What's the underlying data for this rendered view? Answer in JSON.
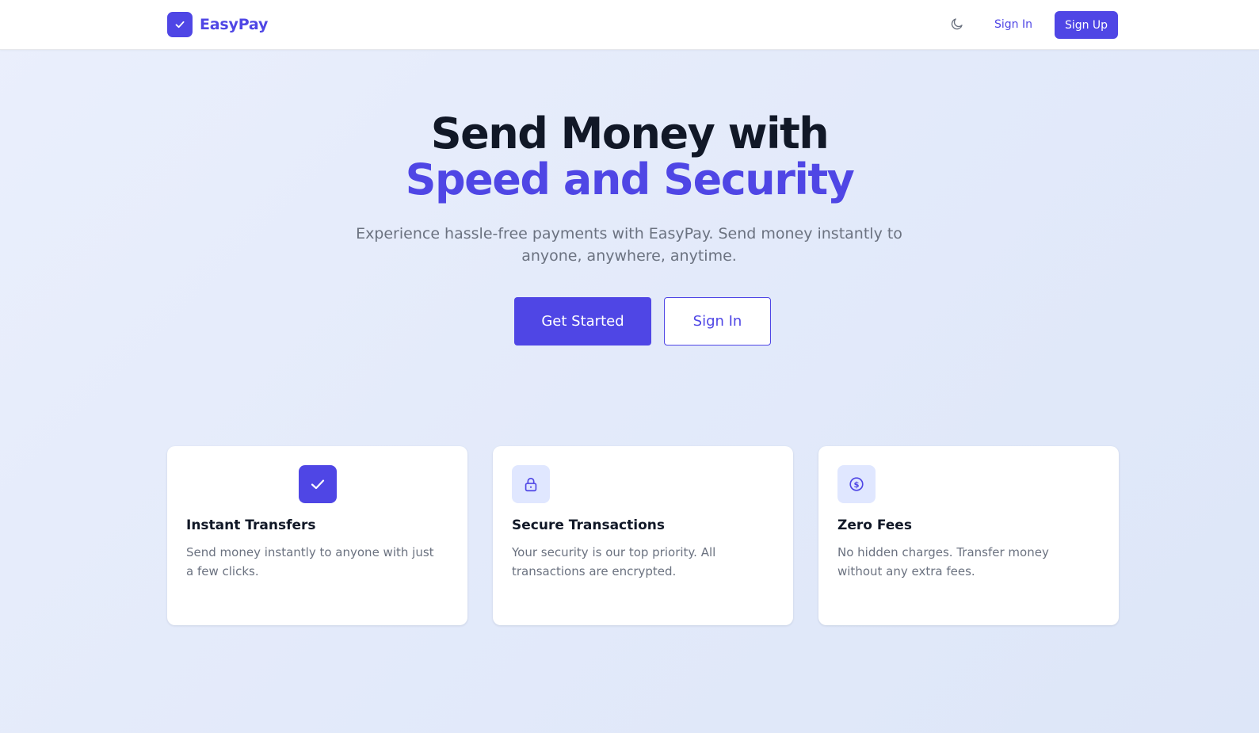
{
  "header": {
    "brand_name": "EasyPay",
    "nav_signin": "Sign In",
    "nav_signup": "Sign Up",
    "theme_icon": "moon-icon"
  },
  "hero": {
    "title_line1": "Send Money with",
    "title_line2": "Speed and Security",
    "subtitle": "Experience hassle-free payments with EasyPay. Send money instantly to anyone, anywhere, anytime.",
    "cta_primary": "Get Started",
    "cta_secondary": "Sign In"
  },
  "features": [
    {
      "icon": "check-icon",
      "title": "Instant Transfers",
      "description": "Send money instantly to anyone with just a few clicks."
    },
    {
      "icon": "lock-icon",
      "title": "Secure Transactions",
      "description": "Your security is our top priority. All transactions are encrypted."
    },
    {
      "icon": "dollar-icon",
      "title": "Zero Fees",
      "description": "No hidden charges. Transfer money without any extra fees."
    }
  ],
  "colors": {
    "brand": "#4f46e5",
    "icon_bg_soft": "#e0e7ff",
    "text_dark": "#111827",
    "text_muted": "#6b7280"
  }
}
